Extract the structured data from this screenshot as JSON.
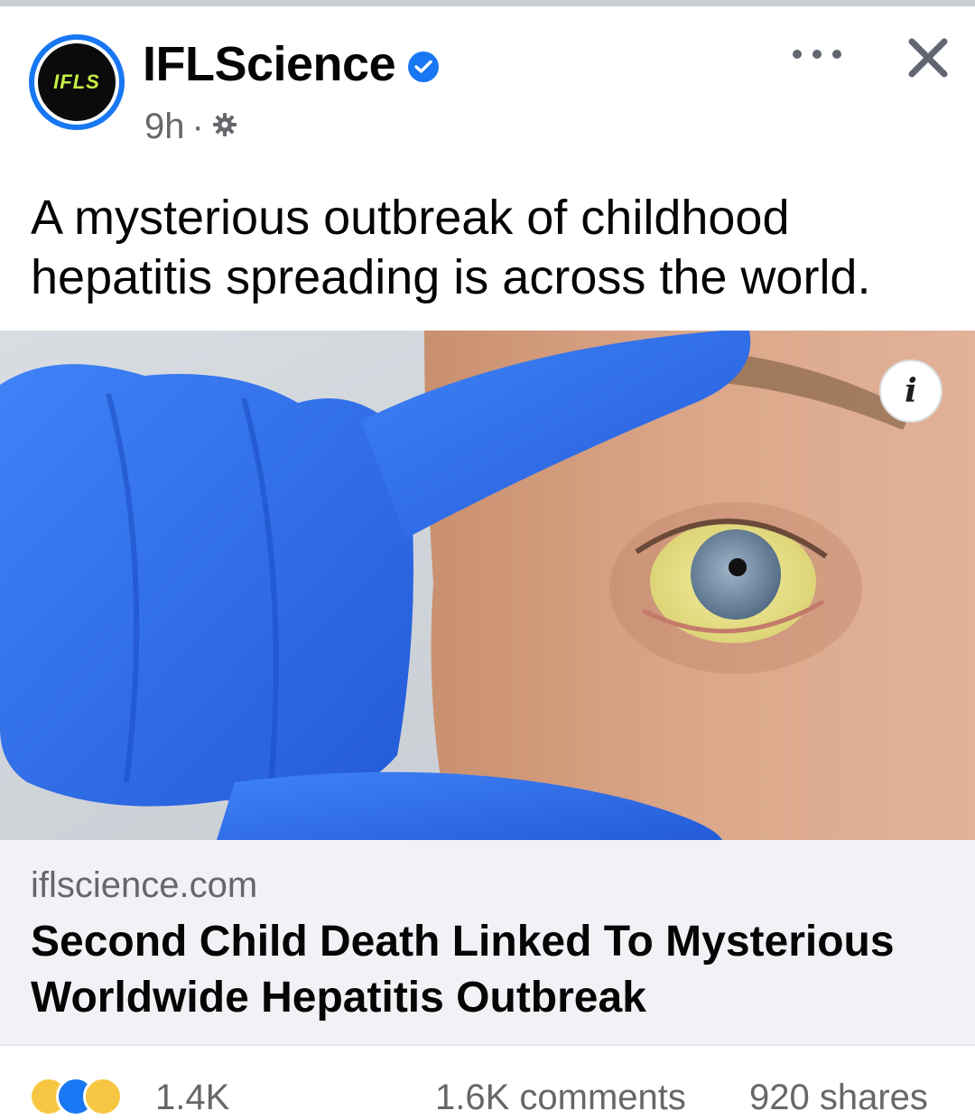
{
  "post": {
    "avatar_text": "IFLS",
    "page_name": "IFLScience",
    "time": "9h",
    "separator": "·",
    "text": "A mysterious outbreak of childhood hepatitis spreading is across the world."
  },
  "image": {
    "info_label": "i"
  },
  "link": {
    "domain": "iflscience.com",
    "title": "Second Child Death Linked To Mysterious Worldwide Hepatitis Outbreak"
  },
  "footer": {
    "reaction_count": "1.4K",
    "comments": "1.6K comments",
    "shares": "920 shares"
  },
  "colors": {
    "brand_blue": "#1877f2",
    "secondary_text": "#65676b",
    "link_background": "#f0f2f5",
    "glove_blue": "#2f6ef0"
  },
  "icons": {
    "verified": "verified-badge-icon",
    "audience": "settings-gear-icon",
    "more": "more-options-icon",
    "close": "close-icon",
    "info": "info-icon"
  }
}
